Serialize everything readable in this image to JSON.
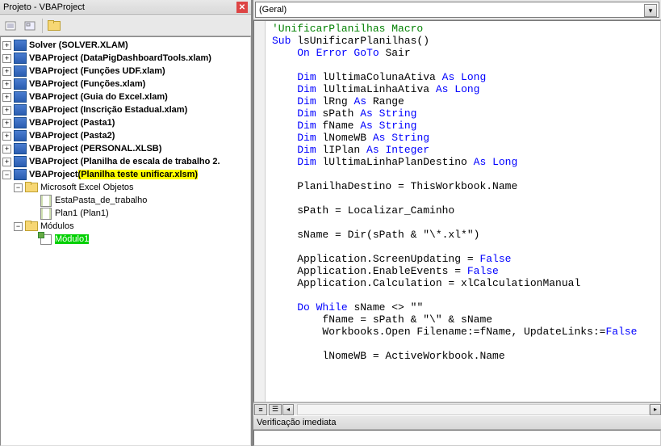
{
  "project_panel": {
    "title": "Projeto - VBAProject",
    "tree": {
      "items": [
        {
          "label": "Solver (SOLVER.XLAM)"
        },
        {
          "label": "VBAProject (DataPigDashboardTools.xlam)"
        },
        {
          "label": "VBAProject (Funções UDF.xlam)"
        },
        {
          "label": "VBAProject (Funções.xlam)"
        },
        {
          "label": "VBAProject (Guia do Excel.xlam)"
        },
        {
          "label": "VBAProject (Inscrição Estadual.xlam)"
        },
        {
          "label": "VBAProject (Pasta1)"
        },
        {
          "label": "VBAProject (Pasta2)"
        },
        {
          "label": "VBAProject (PERSONAL.XLSB)"
        },
        {
          "label": "VBAProject (Planilha de escala de trabalho 2."
        }
      ],
      "active_project": {
        "prefix": "VBAProject ",
        "name": "(Planilha teste unificar.xlsm)"
      },
      "folder_objects": "Microsoft Excel Objetos",
      "obj1": "EstaPasta_de_trabalho",
      "obj2": "Plan1 (Plan1)",
      "folder_modules": "Módulos",
      "selected_module": "Módulo1"
    }
  },
  "code_panel": {
    "combo_general": "(Geral)",
    "code_lines": [
      {
        "segs": [
          {
            "t": "'UnificarPlanilhas Macro",
            "c": "cmt"
          }
        ]
      },
      {
        "segs": [
          {
            "t": "Sub",
            "c": "kw"
          },
          {
            "t": " lsUnificarPlanilhas()"
          }
        ]
      },
      {
        "segs": [
          {
            "t": "    "
          },
          {
            "t": "On Error GoTo",
            "c": "kw"
          },
          {
            "t": " Sair"
          }
        ]
      },
      {
        "segs": []
      },
      {
        "segs": [
          {
            "t": "    "
          },
          {
            "t": "Dim",
            "c": "kw"
          },
          {
            "t": " lUltimaColunaAtiva "
          },
          {
            "t": "As Long",
            "c": "kw"
          }
        ]
      },
      {
        "segs": [
          {
            "t": "    "
          },
          {
            "t": "Dim",
            "c": "kw"
          },
          {
            "t": " lUltimaLinhaAtiva "
          },
          {
            "t": "As Long",
            "c": "kw"
          }
        ]
      },
      {
        "segs": [
          {
            "t": "    "
          },
          {
            "t": "Dim",
            "c": "kw"
          },
          {
            "t": " lRng "
          },
          {
            "t": "As",
            "c": "kw"
          },
          {
            "t": " Range"
          }
        ]
      },
      {
        "segs": [
          {
            "t": "    "
          },
          {
            "t": "Dim",
            "c": "kw"
          },
          {
            "t": " sPath "
          },
          {
            "t": "As String",
            "c": "kw"
          }
        ]
      },
      {
        "segs": [
          {
            "t": "    "
          },
          {
            "t": "Dim",
            "c": "kw"
          },
          {
            "t": " fName "
          },
          {
            "t": "As String",
            "c": "kw"
          }
        ]
      },
      {
        "segs": [
          {
            "t": "    "
          },
          {
            "t": "Dim",
            "c": "kw"
          },
          {
            "t": " lNomeWB "
          },
          {
            "t": "As String",
            "c": "kw"
          }
        ]
      },
      {
        "segs": [
          {
            "t": "    "
          },
          {
            "t": "Dim",
            "c": "kw"
          },
          {
            "t": " lIPlan "
          },
          {
            "t": "As Integer",
            "c": "kw"
          }
        ]
      },
      {
        "segs": [
          {
            "t": "    "
          },
          {
            "t": "Dim",
            "c": "kw"
          },
          {
            "t": " lUltimaLinhaPlanDestino "
          },
          {
            "t": "As Long",
            "c": "kw"
          }
        ]
      },
      {
        "segs": []
      },
      {
        "segs": [
          {
            "t": "    PlanilhaDestino = ThisWorkbook.Name"
          }
        ]
      },
      {
        "segs": []
      },
      {
        "segs": [
          {
            "t": "    sPath = Localizar_Caminho"
          }
        ]
      },
      {
        "segs": []
      },
      {
        "segs": [
          {
            "t": "    sName = Dir(sPath & \"\\*.xl*\")"
          }
        ]
      },
      {
        "segs": []
      },
      {
        "segs": [
          {
            "t": "    Application.ScreenUpdating = "
          },
          {
            "t": "False",
            "c": "kw"
          }
        ]
      },
      {
        "segs": [
          {
            "t": "    Application.EnableEvents = "
          },
          {
            "t": "False",
            "c": "kw"
          }
        ]
      },
      {
        "segs": [
          {
            "t": "    Application.Calculation = xlCalculationManual"
          }
        ]
      },
      {
        "segs": []
      },
      {
        "segs": [
          {
            "t": "    "
          },
          {
            "t": "Do While",
            "c": "kw"
          },
          {
            "t": " sName <> \"\""
          }
        ]
      },
      {
        "segs": [
          {
            "t": "        fName = sPath & \"\\\" & sName"
          }
        ]
      },
      {
        "segs": [
          {
            "t": "        Workbooks.Open Filename:=fName, UpdateLinks:="
          },
          {
            "t": "False",
            "c": "kw"
          }
        ]
      },
      {
        "segs": []
      },
      {
        "segs": [
          {
            "t": "        lNomeWB = ActiveWorkbook.Name"
          }
        ]
      }
    ]
  },
  "immediate": {
    "title": "Verificação imediata"
  }
}
